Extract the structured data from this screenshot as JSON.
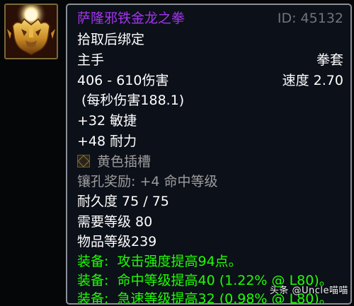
{
  "item": {
    "name": "萨隆邪铁金龙之拳",
    "id_label": "ID: 45132",
    "bind": "拾取后绑定",
    "slot": "主手",
    "weapon_type": "拳套",
    "damage": "406 - 610伤害",
    "speed": "速度 2.70",
    "dps": "(每秒伤害188.1)",
    "stats": [
      "+32 敏捷",
      "+48 耐力"
    ],
    "socket": "黄色插槽",
    "socket_bonus": "镶孔奖励: +4 命中等级",
    "durability": "耐久度 75 / 75",
    "required_level": "需要等级 80",
    "item_level": "物品等级239",
    "equip": [
      {
        "prefix": "装备:",
        "text": "攻击强度提高94点。"
      },
      {
        "prefix": "装备:",
        "text": "命中等级提高40 (1.22% @ L80)。"
      },
      {
        "prefix": "装备:",
        "text": "急速等级提高32 (0.98% @ L80)。"
      }
    ]
  },
  "watermark": "头条 @Uncle喵喵",
  "icon": "golden-dragon-fist-icon",
  "colors": {
    "epic": "#a335ee",
    "equip": "#1eff00",
    "poor": "#9d9d9d",
    "border": "#8a8f98",
    "background": "#0c1019"
  }
}
